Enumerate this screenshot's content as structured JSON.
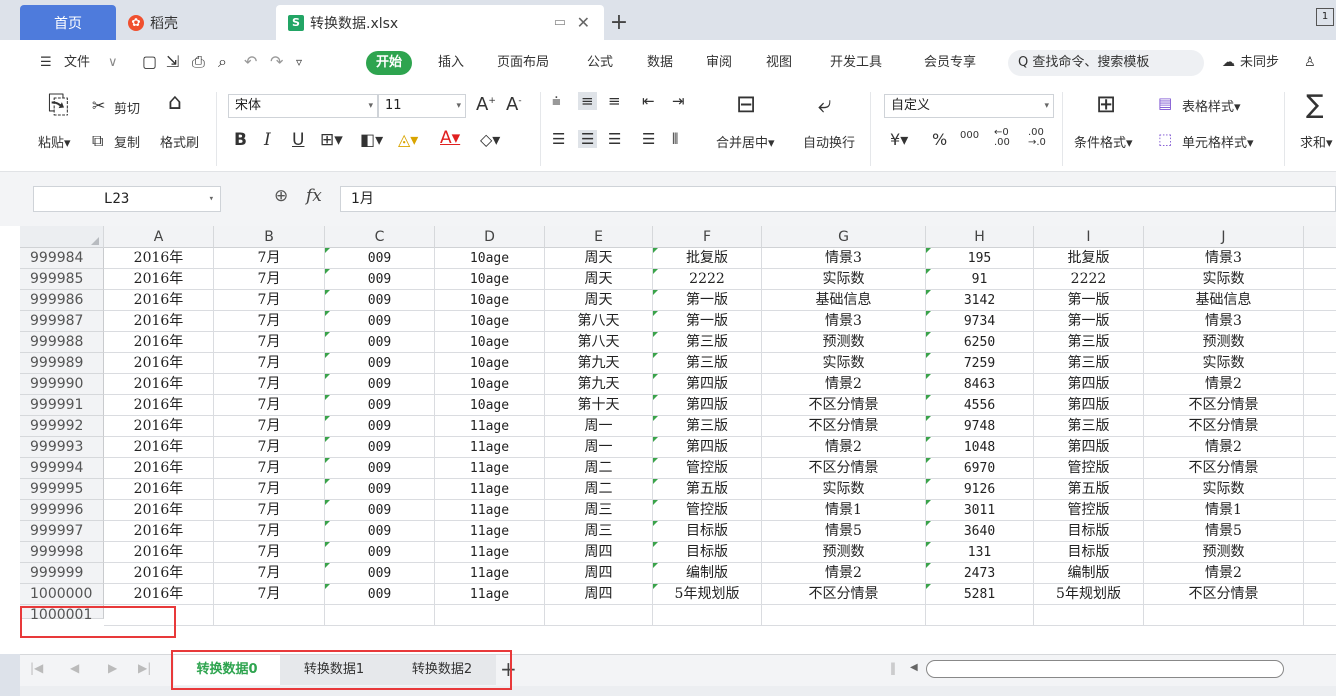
{
  "tabs": {
    "home": "首页",
    "docer": "稻壳",
    "file": "转换数据.xlsx",
    "right_badge": "1"
  },
  "menu": {
    "file": "文件",
    "items": [
      "开始",
      "插入",
      "页面布局",
      "公式",
      "数据",
      "审阅",
      "视图",
      "开发工具",
      "会员专享"
    ],
    "search": "查找命令、搜索模板",
    "sync": "未同步"
  },
  "ribbon": {
    "paste": "粘贴",
    "cut": "剪切",
    "copy": "复制",
    "format_painter": "格式刷",
    "font_name": "宋体",
    "font_size": "11",
    "merge": "合并居中",
    "wrap": "自动换行",
    "number_format": "自定义",
    "cond_format": "条件格式",
    "table_style": "表格样式",
    "cell_style": "单元格样式",
    "sum": "求和",
    "currency": "¥",
    "percent": "%",
    "thousands": "000",
    "bold": "B",
    "italic": "I",
    "underline": "U"
  },
  "formula_bar": {
    "cell_ref": "L23",
    "fx": "fx",
    "content": "1月"
  },
  "grid": {
    "columns": [
      "A",
      "B",
      "C",
      "D",
      "E",
      "F",
      "G",
      "H",
      "I",
      "J"
    ],
    "rows": [
      {
        "n": "999984",
        "c": [
          "2016年",
          "7月",
          "009",
          "10age",
          "周天",
          "批复版",
          "情景3",
          "195",
          "批复版",
          "情景3"
        ]
      },
      {
        "n": "999985",
        "c": [
          "2016年",
          "7月",
          "009",
          "10age",
          "周天",
          "2222",
          "实际数",
          "91",
          "2222",
          "实际数"
        ]
      },
      {
        "n": "999986",
        "c": [
          "2016年",
          "7月",
          "009",
          "10age",
          "周天",
          "第一版",
          "基础信息",
          "3142",
          "第一版",
          "基础信息"
        ]
      },
      {
        "n": "999987",
        "c": [
          "2016年",
          "7月",
          "009",
          "10age",
          "第八天",
          "第一版",
          "情景3",
          "9734",
          "第一版",
          "情景3"
        ]
      },
      {
        "n": "999988",
        "c": [
          "2016年",
          "7月",
          "009",
          "10age",
          "第八天",
          "第三版",
          "预测数",
          "6250",
          "第三版",
          "预测数"
        ]
      },
      {
        "n": "999989",
        "c": [
          "2016年",
          "7月",
          "009",
          "10age",
          "第九天",
          "第三版",
          "实际数",
          "7259",
          "第三版",
          "实际数"
        ]
      },
      {
        "n": "999990",
        "c": [
          "2016年",
          "7月",
          "009",
          "10age",
          "第九天",
          "第四版",
          "情景2",
          "8463",
          "第四版",
          "情景2"
        ]
      },
      {
        "n": "999991",
        "c": [
          "2016年",
          "7月",
          "009",
          "10age",
          "第十天",
          "第四版",
          "不区分情景",
          "4556",
          "第四版",
          "不区分情景"
        ]
      },
      {
        "n": "999992",
        "c": [
          "2016年",
          "7月",
          "009",
          "11age",
          "周一",
          "第三版",
          "不区分情景",
          "9748",
          "第三版",
          "不区分情景"
        ]
      },
      {
        "n": "999993",
        "c": [
          "2016年",
          "7月",
          "009",
          "11age",
          "周一",
          "第四版",
          "情景2",
          "1048",
          "第四版",
          "情景2"
        ]
      },
      {
        "n": "999994",
        "c": [
          "2016年",
          "7月",
          "009",
          "11age",
          "周二",
          "管控版",
          "不区分情景",
          "6970",
          "管控版",
          "不区分情景"
        ]
      },
      {
        "n": "999995",
        "c": [
          "2016年",
          "7月",
          "009",
          "11age",
          "周二",
          "第五版",
          "实际数",
          "9126",
          "第五版",
          "实际数"
        ]
      },
      {
        "n": "999996",
        "c": [
          "2016年",
          "7月",
          "009",
          "11age",
          "周三",
          "管控版",
          "情景1",
          "3011",
          "管控版",
          "情景1"
        ]
      },
      {
        "n": "999997",
        "c": [
          "2016年",
          "7月",
          "009",
          "11age",
          "周三",
          "目标版",
          "情景5",
          "3640",
          "目标版",
          "情景5"
        ]
      },
      {
        "n": "999998",
        "c": [
          "2016年",
          "7月",
          "009",
          "11age",
          "周四",
          "目标版",
          "预测数",
          "131",
          "目标版",
          "预测数"
        ]
      },
      {
        "n": "999999",
        "c": [
          "2016年",
          "7月",
          "009",
          "11age",
          "周四",
          "编制版",
          "情景2",
          "2473",
          "编制版",
          "情景2"
        ]
      },
      {
        "n": "1000000",
        "c": [
          "2016年",
          "7月",
          "009",
          "11age",
          "周四",
          "5年规划版",
          "不区分情景",
          "5281",
          "5年规划版",
          "不区分情景"
        ]
      },
      {
        "n": "1000001",
        "c": [
          "",
          "",
          "",
          "",
          "",
          "",
          "",
          "",
          "",
          ""
        ]
      }
    ]
  },
  "sheets": [
    "转换数据0",
    "转换数据1",
    "转换数据2"
  ],
  "active_sheet": 0,
  "colors": {
    "accent_green": "#2ea44f",
    "tab_blue": "#4e7bdc",
    "highlight_red": "#e8393a"
  }
}
